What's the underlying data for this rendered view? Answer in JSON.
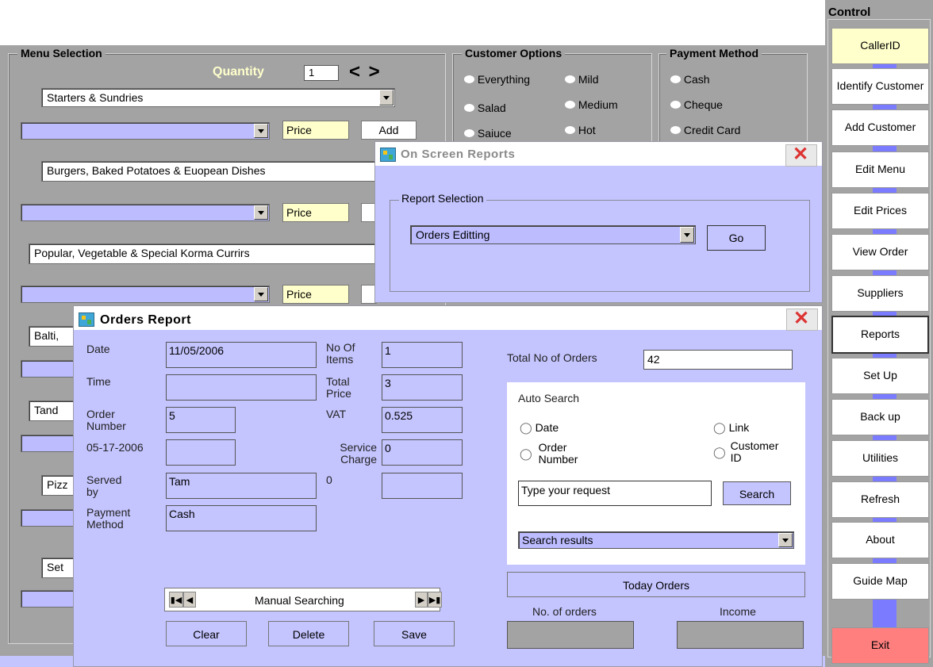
{
  "menu": {
    "legend": "Menu Selection",
    "quantity_label": "Quantity",
    "quantity_value": "1",
    "arrows": "< >",
    "categories": [
      "Starters  & Sundries",
      "Burgers, Baked Potatoes & Euopean Dishes",
      "Popular, Vegetable &  Special Korma Currirs",
      "Balti,",
      "Tand",
      "Pizz",
      "Set"
    ],
    "price_label": "Price",
    "add_label": "Add"
  },
  "customer_options": {
    "legend": "Customer  Options",
    "options": [
      "Everything",
      "Mild",
      "Salad",
      "Medium",
      "Saiuce",
      "Hot"
    ]
  },
  "payment": {
    "legend": "Payment Method",
    "options": [
      "Cash",
      "Cheque",
      "Credit Card"
    ]
  },
  "control": {
    "title": "Control",
    "buttons": [
      "CallerID",
      "Identify Customer",
      "Add Customer",
      "Edit Menu",
      "Edit Prices",
      "View Order",
      "Suppliers",
      "Reports",
      "Set Up",
      "Back up",
      "Utilities",
      "Refresh",
      "About",
      "Guide Map"
    ],
    "exit": "Exit",
    "colors": {
      "callerid": "#ffffcc",
      "exit": "#ff7f7f",
      "panel": "#a3a3a3"
    }
  },
  "reports_window": {
    "title": "On Screen Reports",
    "group_label": "Report Selection",
    "selected": "Orders Editting",
    "go": "Go"
  },
  "orders_report": {
    "title": "Orders Report",
    "date_label": "Date",
    "date_value": "11/05/2006",
    "time_label": "Time",
    "time_value": "",
    "order_number_label": "Order Number",
    "order_number_value": "5",
    "date2_label": "05-17-2006",
    "date2_value": "",
    "served_by_label": "Served by",
    "served_by_value": "Tam",
    "payment_method_label": "Payment Method",
    "payment_method_value": "Cash",
    "no_items_label": "No Of Items",
    "no_items_value": "1",
    "total_price_label": "Total Price",
    "total_price_value": "3",
    "vat_label": "VAT",
    "vat_value": "0.525",
    "service_label": "Service Charge",
    "service_value": "0",
    "zero_label": "0",
    "zero_value": "",
    "total_orders_label": "Total No of Orders",
    "total_orders_value": "42",
    "auto_search": {
      "label": "Auto Search",
      "options": [
        "Date",
        "Link",
        "Order Number",
        "Customer ID"
      ],
      "input_value": "Type your request",
      "search_button": "Search",
      "results": "Search results"
    },
    "today_orders": "Today Orders",
    "no_of_orders_label": "No. of orders",
    "income_label": "Income",
    "manual_searching": "Manual Searching",
    "clear": "Clear",
    "delete": "Delete",
    "save": "Save"
  }
}
